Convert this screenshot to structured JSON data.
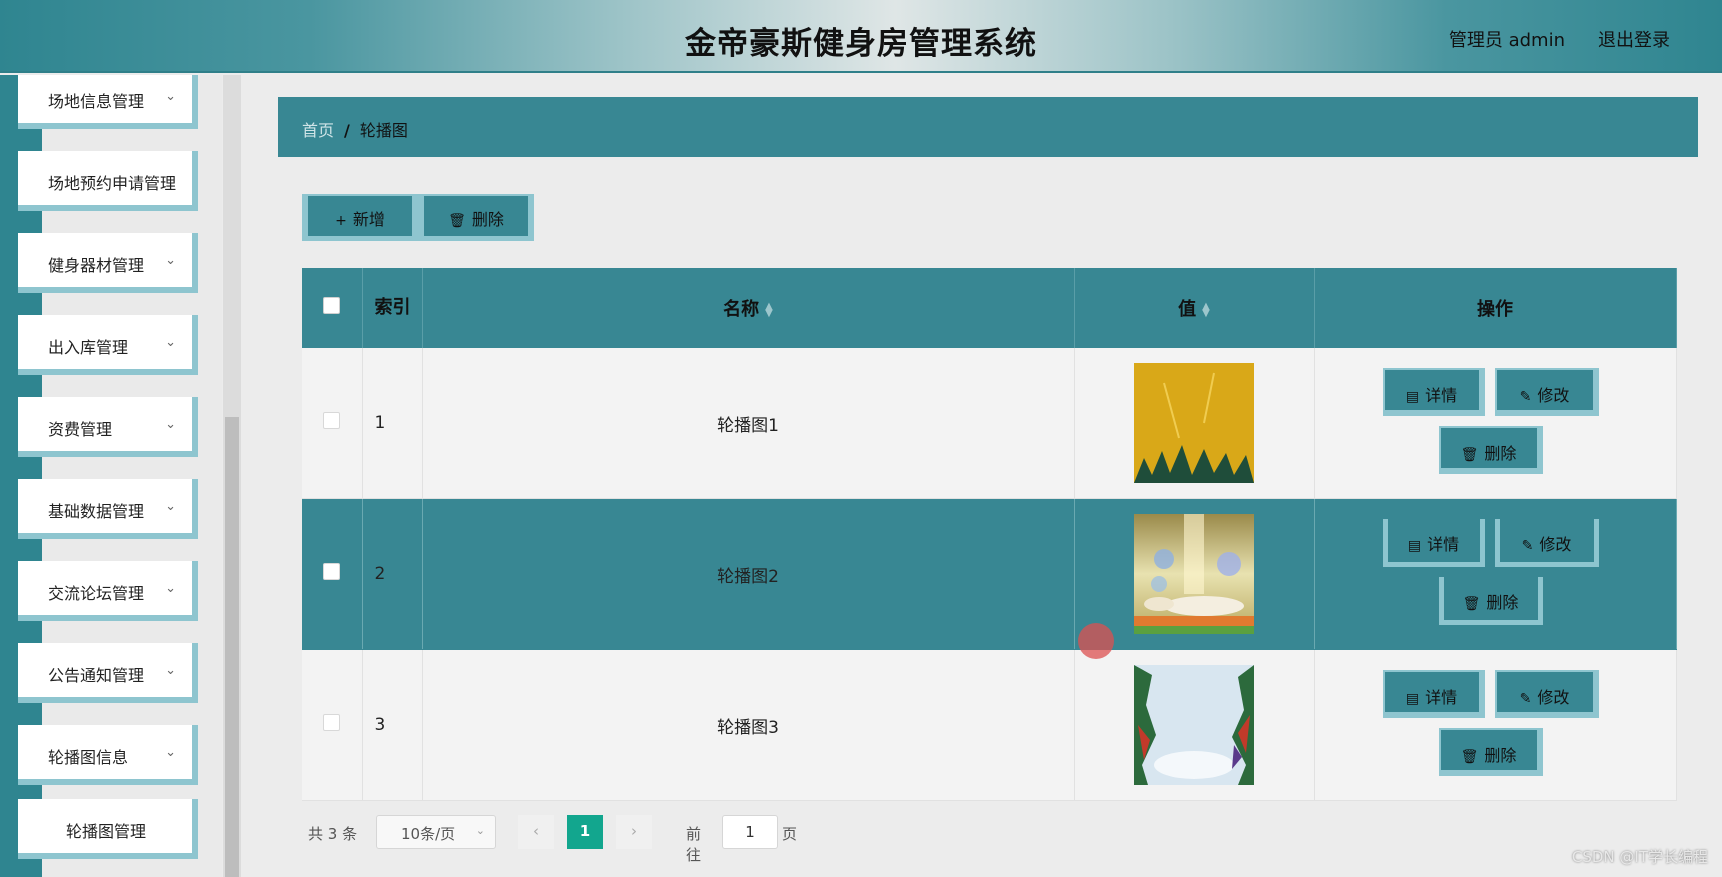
{
  "app": {
    "title": "金帝豪斯健身房管理系统",
    "user": "管理员 admin",
    "logout": "退出登录"
  },
  "sidebar": {
    "items": [
      {
        "label": "场地信息管理",
        "expandable": true
      },
      {
        "label": "场地预约申请管理",
        "expandable": false
      },
      {
        "label": "健身器材管理",
        "expandable": true
      },
      {
        "label": "出入库管理",
        "expandable": true
      },
      {
        "label": "资费管理",
        "expandable": true
      },
      {
        "label": "基础数据管理",
        "expandable": true
      },
      {
        "label": "交流论坛管理",
        "expandable": true
      },
      {
        "label": "公告通知管理",
        "expandable": true
      },
      {
        "label": "轮播图信息",
        "expandable": true
      },
      {
        "label": "轮播图管理",
        "expandable": false,
        "active": true
      }
    ]
  },
  "breadcrumb": {
    "home": "首页",
    "separator": "/",
    "current": "轮播图"
  },
  "toolbar": {
    "add_label": "新增",
    "delete_label": "删除"
  },
  "table": {
    "headers": {
      "index": "索引",
      "name": "名称",
      "value": "值",
      "actions": "操作"
    },
    "rows": [
      {
        "index": "1",
        "name": "轮播图1",
        "image": "yellow-grass-banner",
        "highlighted": false
      },
      {
        "index": "2",
        "name": "轮播图2",
        "image": "stage-flowers-banner",
        "highlighted": true
      },
      {
        "index": "3",
        "name": "轮播图3",
        "image": "sky-leaves-banner",
        "highlighted": false
      }
    ],
    "row_actions": {
      "detail": "详情",
      "edit": "修改",
      "delete": "删除"
    }
  },
  "pagination": {
    "total": "共 3 条",
    "page_size": "10条/页",
    "current_page": "1",
    "goto_label": "前往",
    "goto_value": "1",
    "page_suffix": "页"
  },
  "watermark": "CSDN @IT学长编程",
  "colors": {
    "primary": "#388793",
    "accent_border": "#8ec5cf",
    "pager_active": "#12a68e"
  }
}
